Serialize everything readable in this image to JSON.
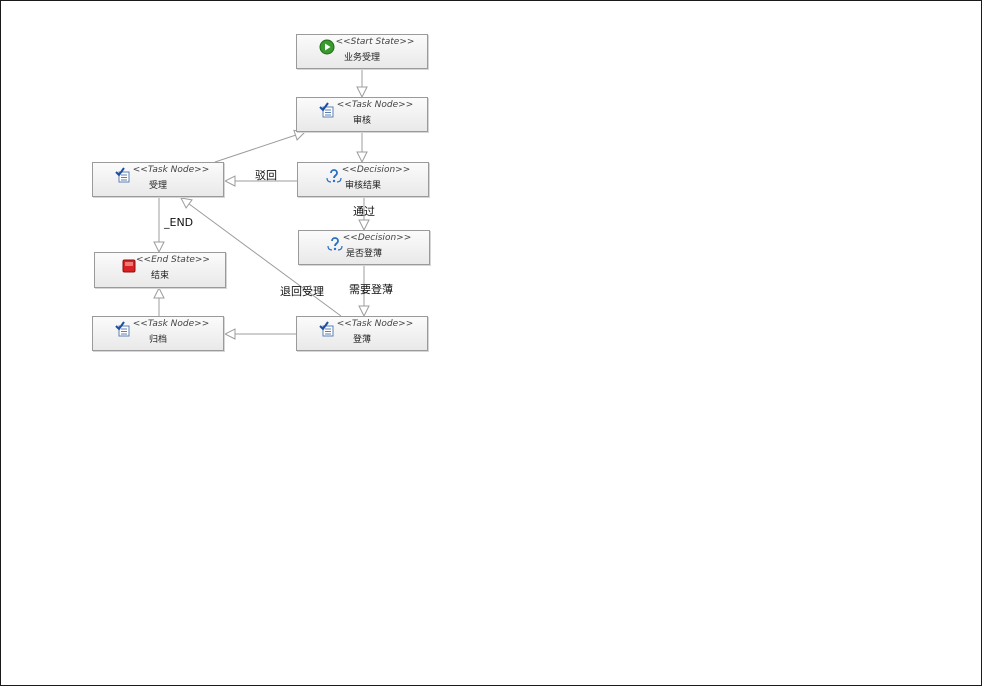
{
  "nodes": {
    "start": {
      "stereotype": "<<Start State>>",
      "name": "业务受理",
      "icon": "start-icon"
    },
    "review": {
      "stereotype": "<<Task Node>>",
      "name": "审核",
      "icon": "task-icon"
    },
    "accept": {
      "stereotype": "<<Task Node>>",
      "name": "受理",
      "icon": "task-icon"
    },
    "decision1": {
      "stereotype": "<<Decision>>",
      "name": "审核结果",
      "icon": "decision-icon"
    },
    "decision2": {
      "stereotype": "<<Decision>>",
      "name": "是否登薄",
      "icon": "decision-icon"
    },
    "end": {
      "stereotype": "<<End State>>",
      "name": "结束",
      "icon": "end-icon"
    },
    "archive": {
      "stereotype": "<<Task Node>>",
      "name": "归档",
      "icon": "task-icon"
    },
    "register": {
      "stereotype": "<<Task Node>>",
      "name": "登薄",
      "icon": "task-icon"
    }
  },
  "edges": {
    "reject": "驳回",
    "pass": "通过",
    "end_edge": "_END",
    "need_reg": "需要登薄",
    "return": "退回受理"
  },
  "colors": {
    "start": "#3a9a2e",
    "end": "#d92121",
    "task": "#2a6fc4",
    "line": "#9c9c9c"
  }
}
